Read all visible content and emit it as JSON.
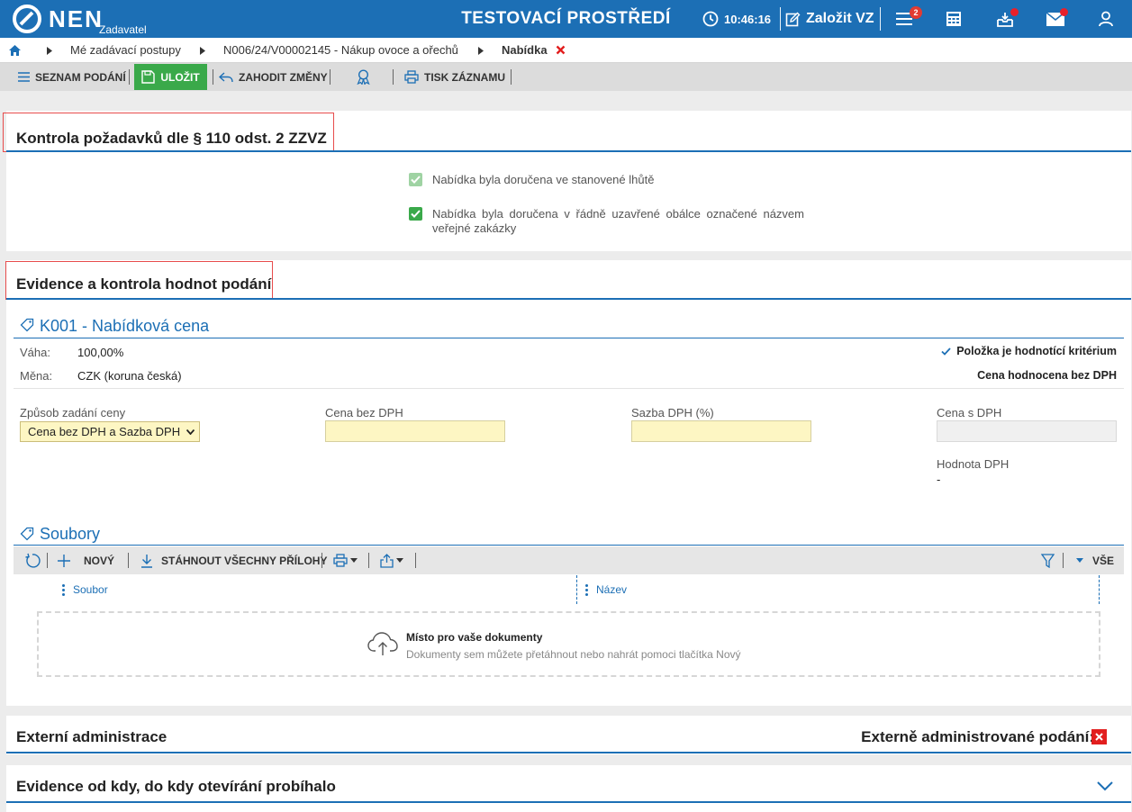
{
  "header": {
    "logo_text": "NEN",
    "logo_sub": "Zadavatel",
    "env_label": "TESTOVACÍ PROSTŘEDÍ",
    "time": "10:46:16",
    "create_label": "Založit VZ",
    "menu_badge": "2",
    "brand_color": "#1c6fb5"
  },
  "breadcrumb": {
    "items": [
      "Mé zadávací postupy",
      "N006/24/V00002145 - Nákup ovoce a ořechů",
      "Nabídka"
    ]
  },
  "toolbar": {
    "list_label": "SEZNAM PODÁNÍ",
    "save_label": "ULOŽIT",
    "discard_label": "ZAHODIT ZMĚNY",
    "print_label": "TISK ZÁZNAMU"
  },
  "check_section": {
    "title": "Kontrola požadavků dle § 110 odst. 2 ZZVZ",
    "items": [
      {
        "label": "Nabídka byla doručena ve stanovené lhůtě",
        "checked": true,
        "disabled": true
      },
      {
        "label": "Nabídka byla doručena v řádně uzavřené obálce označené názvem veřejné zakázky",
        "checked": true,
        "disabled": false
      }
    ]
  },
  "evidence_section": {
    "title": "Evidence a kontrola hodnot podání",
    "criterion": {
      "title": "K001 - Nabídková cena",
      "weight_label": "Váha:",
      "weight_value": "100,00%",
      "currency_label": "Měna:",
      "currency_value": "CZK (koruna česká)",
      "criterion_flag": "Položka je hodnotící kritérium",
      "evaluated_note": "Cena hodnocena bez DPH"
    },
    "form": {
      "mode_label": "Způsob zadání ceny",
      "mode_value": "Cena bez DPH a Sazba DPH",
      "price_label": "Cena bez DPH",
      "price_value": "",
      "vat_rate_label": "Sazba DPH (%)",
      "vat_rate_value": "",
      "price_vat_label": "Cena s DPH",
      "price_vat_value": "",
      "vat_amount_label": "Hodnota DPH",
      "vat_amount_value": "-"
    }
  },
  "files": {
    "title": "Soubory",
    "new_label": "NOVÝ",
    "download_all_label": "STÁHNOUT VŠECHNY PŘÍLOHY",
    "all_label": "VŠE",
    "columns": [
      "Soubor",
      "Název"
    ],
    "drop_title": "Místo pro vaše dokumenty",
    "drop_hint": "Dokumenty sem můžete přetáhnout nebo nahrát pomoci tlačítka Nový"
  },
  "external": {
    "title": "Externí administrace",
    "flag_label": "Externě administrované podání:"
  },
  "opening": {
    "title": "Evidence od kdy, do kdy otevírání probíhalo"
  }
}
